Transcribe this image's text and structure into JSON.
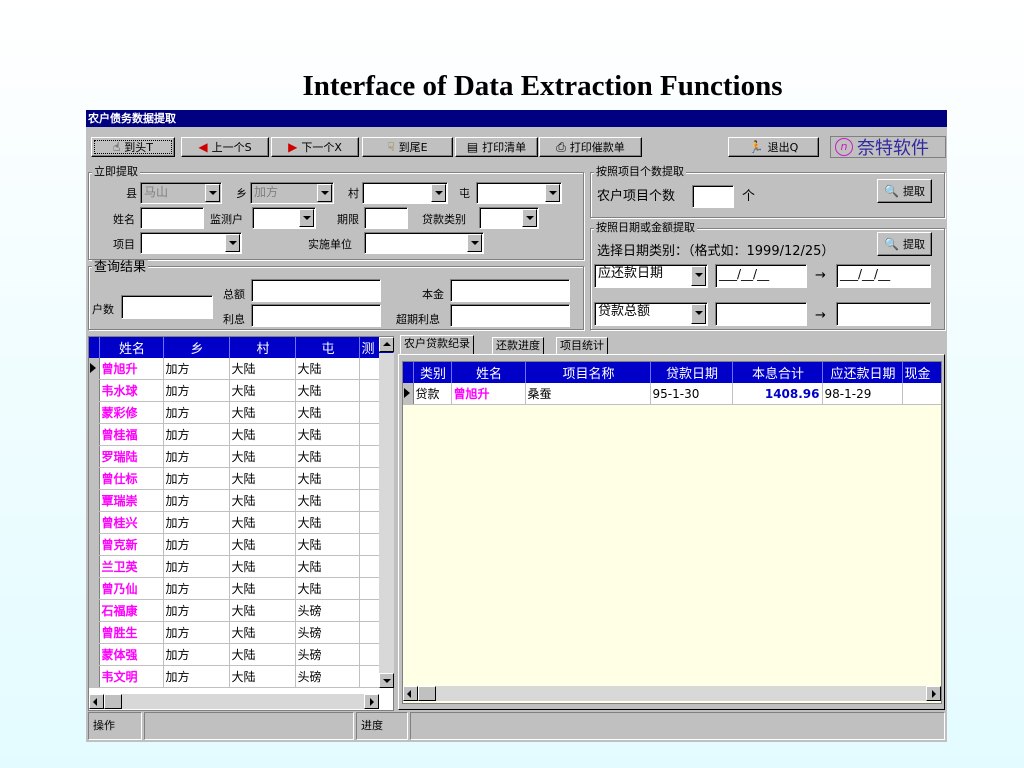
{
  "slide_title": "Interface of Data Extraction Functions",
  "window": {
    "title": "农户债务数据提取",
    "colors": {
      "title_bg": "#000080",
      "header_bg": "#0000c8",
      "name_color": "#ff00ff",
      "amount_color": "#0000c8",
      "logo_color": "#c81ec8"
    }
  },
  "toolbar": {
    "first": {
      "label": "到头T",
      "icon": "hand-pointer-icon"
    },
    "prev": {
      "label": "上一个S",
      "icon": "arrow-left-icon"
    },
    "next": {
      "label": "下一个X",
      "icon": "arrow-right-icon"
    },
    "last": {
      "label": "到尾E",
      "icon": "hand-down-icon"
    },
    "print_list": {
      "label": "打印清单",
      "icon": "document-icon"
    },
    "print_notice": {
      "label": "打印催款单",
      "icon": "printer-icon"
    },
    "exit": {
      "label": "退出Q",
      "icon": "running-man-icon"
    },
    "logo": {
      "mark": "n",
      "text": "奈特软件"
    }
  },
  "immediate": {
    "group_label": "立即提取",
    "county_label": "县",
    "county_value": "马山",
    "township_label": "乡",
    "township_value": "加方",
    "village_label": "村",
    "village_value": "",
    "tun_label": "屯",
    "tun_value": "",
    "name_label": "姓名",
    "name_value": "",
    "monitor_label": "监测户",
    "monitor_value": "",
    "term_label": "期限",
    "term_value": "",
    "loan_type_label": "贷款类别",
    "loan_type_value": "",
    "project_label": "项目",
    "project_value": "",
    "unit_label": "实施单位",
    "unit_value": ""
  },
  "query": {
    "group_label": "查询结果",
    "households_label": "户数",
    "households_value": "",
    "total_label": "总额",
    "total_value": "",
    "interest_label": "利息",
    "interest_value": "",
    "principal_label": "本金",
    "principal_value": "",
    "overdue_label": "超期利息",
    "overdue_value": ""
  },
  "by_count": {
    "group_label": "按照项目个数提取",
    "label": "农户项目个数",
    "value": "",
    "unit": "个",
    "button": "提取"
  },
  "by_date": {
    "group_label": "按照日期或金额提取",
    "hint": "选择日期类别：（格式如：1999/12/25）",
    "button": "提取",
    "date_type": "应还款日期",
    "date_from": "___/__/__",
    "arrow": "→",
    "date_to": "___/__/__",
    "amount_type": "贷款总额",
    "amount_from": "",
    "amount_to": ""
  },
  "left_grid": {
    "columns": [
      "姓名",
      "乡",
      "村",
      "屯",
      "测"
    ],
    "rows": [
      [
        "曾旭升",
        "加方",
        "大陆",
        "大陆"
      ],
      [
        "韦水球",
        "加方",
        "大陆",
        "大陆"
      ],
      [
        "蒙彩修",
        "加方",
        "大陆",
        "大陆"
      ],
      [
        "曾桂福",
        "加方",
        "大陆",
        "大陆"
      ],
      [
        "罗瑞陆",
        "加方",
        "大陆",
        "大陆"
      ],
      [
        "曾仕标",
        "加方",
        "大陆",
        "大陆"
      ],
      [
        "覃瑞崇",
        "加方",
        "大陆",
        "大陆"
      ],
      [
        "曾桂兴",
        "加方",
        "大陆",
        "大陆"
      ],
      [
        "曾克新",
        "加方",
        "大陆",
        "大陆"
      ],
      [
        "兰卫英",
        "加方",
        "大陆",
        "大陆"
      ],
      [
        "曾乃仙",
        "加方",
        "大陆",
        "大陆"
      ],
      [
        "石福康",
        "加方",
        "大陆",
        "头磅"
      ],
      [
        "曾胜生",
        "加方",
        "大陆",
        "头磅"
      ],
      [
        "蒙体强",
        "加方",
        "大陆",
        "头磅"
      ],
      [
        "韦文明",
        "加方",
        "大陆",
        "头磅"
      ]
    ]
  },
  "tabs": [
    "农户贷款纪录",
    "还款进度",
    "项目统计"
  ],
  "right_grid": {
    "columns": [
      "类别",
      "姓名",
      "项目名称",
      "贷款日期",
      "本息合计",
      "应还款日期",
      "现金"
    ],
    "rows": [
      [
        "贷款",
        "曾旭升",
        "桑蚕",
        "95-1-30",
        "1408.96",
        "98-1-29",
        ""
      ]
    ]
  },
  "status": {
    "operation_label": "操作",
    "progress_label": "进度"
  }
}
